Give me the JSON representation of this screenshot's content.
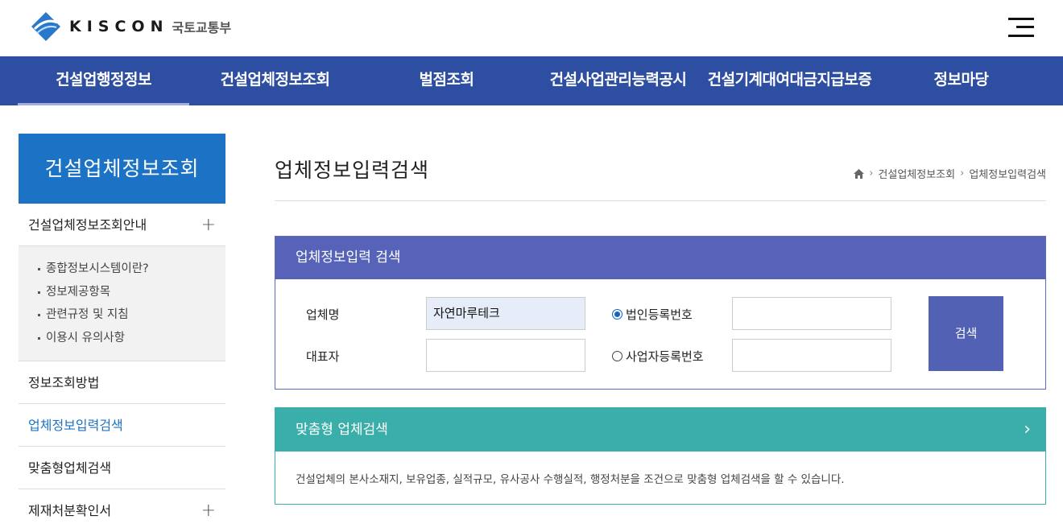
{
  "header": {
    "logo_text": "KISCON",
    "logo_sub": "국토교통부"
  },
  "gnb": [
    {
      "label": "건설업행정정보",
      "active": true
    },
    {
      "label": "건설업체정보조회",
      "active": false
    },
    {
      "label": "벌점조회",
      "active": false
    },
    {
      "label": "건설사업관리능력공시",
      "active": false
    },
    {
      "label": "건설기계대여대금지급보증",
      "active": false
    },
    {
      "label": "정보마당",
      "active": false
    }
  ],
  "sidebar": {
    "title": "건설업체정보조회",
    "items": [
      {
        "label": "건설업체정보조회안내",
        "plus": "+"
      },
      {
        "label": "정보조회방법"
      },
      {
        "label": "업체정보입력검색"
      },
      {
        "label": "맞춤형업체검색"
      },
      {
        "label": "제재처분확인서",
        "plus": "+"
      }
    ],
    "sub_items": [
      "종합정보시스템이란?",
      "정보제공항목",
      "관련규정 및 지침",
      "이용시 유의사항"
    ]
  },
  "main": {
    "title": "업체정보입력검색",
    "breadcrumb": [
      "건설업체정보조회",
      "업체정보입력검색"
    ],
    "search_box": {
      "header": "업체정보입력 검색",
      "company_label": "업체명",
      "company_value": "자연마루테크",
      "rep_label": "대표자",
      "rep_value": "",
      "radio_corp": "법인등록번호",
      "radio_biz": "사업자등록번호",
      "selected_radio": "법인등록번호",
      "corp_value": "",
      "biz_value": "",
      "button": "검색"
    },
    "custom_box": {
      "header": "맞춤형 업체검색",
      "chevron": "›",
      "description": "건설업체의 본사소재지, 보유업종, 실적규모, 유사공사 수행실적, 행정처분을 조건으로 맞춤형 업체검색을 할 수 있습니다."
    }
  },
  "colors": {
    "gnb_bg": "#2e4ea1",
    "lnb_title_bg": "#1c72c4",
    "search_header_bg": "#5763b8",
    "custom_header_bg": "#3aaea9"
  }
}
